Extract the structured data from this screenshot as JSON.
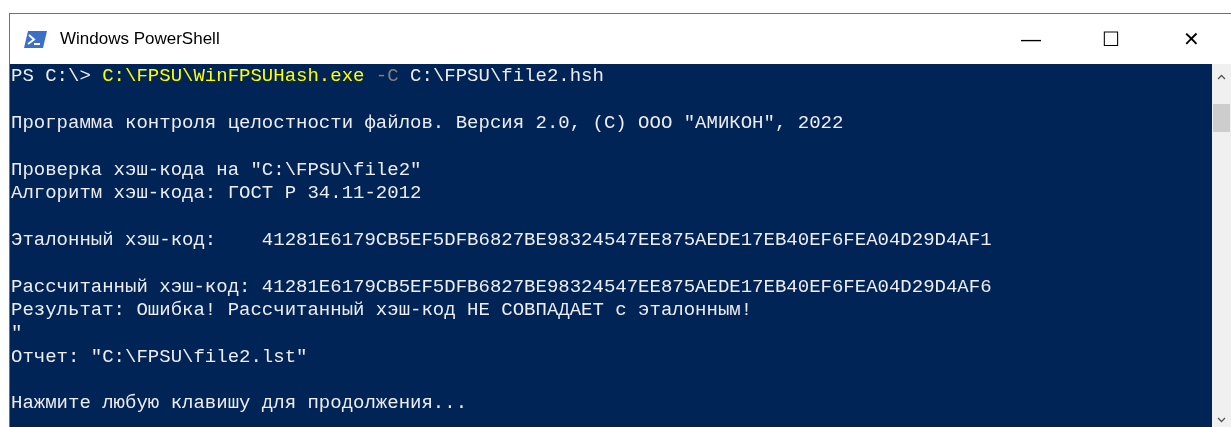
{
  "window": {
    "title": "Windows PowerShell",
    "controls": [
      "—",
      "☐",
      "✕"
    ]
  },
  "console": {
    "lines": [
      {
        "kind": "command",
        "segments": [
          {
            "kind": "prompt",
            "text": "PS C:\\> "
          },
          {
            "kind": "command",
            "text": "C:\\FPSU\\WinFPSUHash.exe"
          },
          {
            "kind": "parameter",
            "text": " -C"
          },
          {
            "kind": "argument",
            "text": " C:\\FPSU\\file2.hsh"
          }
        ]
      },
      {
        "kind": "blank"
      },
      {
        "kind": "output",
        "text": "Программа контроля целостности файлов. Версия 2.0, (C) ООО \"АМИКОН\", 2022"
      },
      {
        "kind": "blank"
      },
      {
        "kind": "output",
        "text": "Проверка хэш-кода на \"C:\\FPSU\\file2\""
      },
      {
        "kind": "output",
        "text": "Алгоритм хэш-кода: ГОСТ Р 34.11-2012"
      },
      {
        "kind": "blank"
      },
      {
        "kind": "output",
        "text": "Эталонный хэш-код:    41281E6179CB5EF5DFB6827BE98324547EE875AEDE17EB40EF6FEA04D29D4AF1"
      },
      {
        "kind": "blank"
      },
      {
        "kind": "output",
        "text": "Рассчитанный хэш-код: 41281E6179CB5EF5DFB6827BE98324547EE875AEDE17EB40EF6FEA04D29D4AF6"
      },
      {
        "kind": "output",
        "text": "Результат: Ошибка! Рассчитанный хэш-код НЕ СОВПАДАЕТ с эталонным!"
      },
      {
        "kind": "output",
        "text": "\""
      },
      {
        "kind": "output",
        "text": "Отчет: \"C:\\FPSU\\file2.lst\""
      },
      {
        "kind": "blank"
      },
      {
        "kind": "output",
        "text": "Нажмите любую клавишу для продолжения..."
      }
    ]
  }
}
